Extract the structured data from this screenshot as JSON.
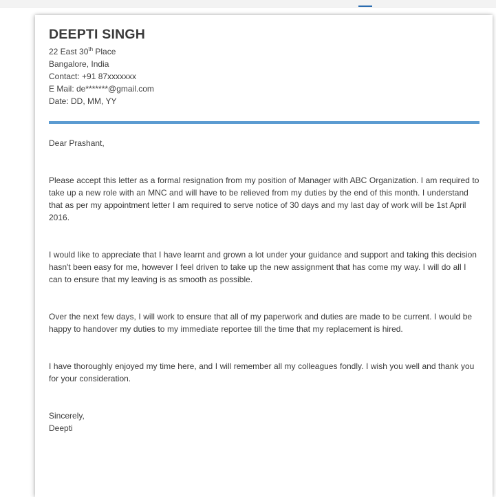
{
  "sender": {
    "name": "DEEPTI SINGH",
    "address_street_pre": "22 East 30",
    "address_street_sup": "th",
    "address_street_post": " Place",
    "address_city": "Bangalore, India",
    "contact": "Contact: +91 87xxxxxxx",
    "email": "E Mail: de*******@gmail.com",
    "date": "Date: DD, MM, YY"
  },
  "colors": {
    "rule": "#5b9bd1",
    "text": "#3a3a3a"
  },
  "letter": {
    "salutation": "Dear Prashant,",
    "paragraphs": [
      "Please accept this letter as a formal resignation from my position of Manager with ABC Organization. I am required to take up a new role with an MNC and will have to be relieved from my duties by the end of this month. I understand that as per my appointment letter I am required to serve notice of 30 days and my last day of work will be 1st April 2016.",
      "I would like to appreciate that I have learnt and grown a lot under your guidance and support and taking this decision hasn't been easy for me, however I feel driven to take up the new assignment that has come my way. I will do all I can to ensure that my leaving is as smooth as possible.",
      "Over the next few days, I will work to ensure that all of my paperwork and duties are made to be current. I would be happy to handover my duties to my immediate reportee till the time that my replacement is hired.",
      "I have thoroughly enjoyed my time here, and I will remember all my colleagues fondly. I wish you well and thank you for your consideration."
    ],
    "closing": "Sincerely,",
    "signature": "Deepti"
  }
}
